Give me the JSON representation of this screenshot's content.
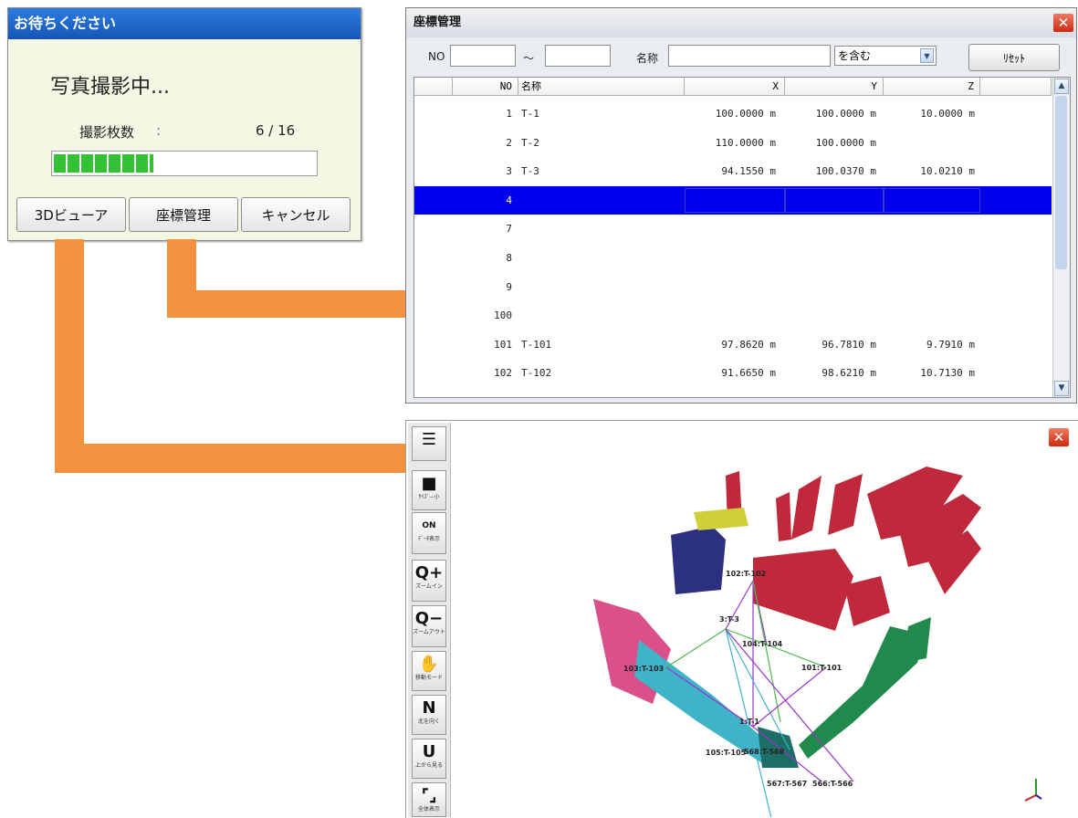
{
  "wait_dialog": {
    "title": "お待ちください",
    "message": "写真撮影中...",
    "count_label": "撮影枚数",
    "count_separator": ":",
    "count_value": "6 / 16",
    "progress_fraction": 0.375,
    "buttons": [
      "3Dビューア",
      "座標管理",
      "キャンセル"
    ]
  },
  "coord_dialog": {
    "title": "座標管理",
    "close_glyph": "✕",
    "filter": {
      "no_label": "NO",
      "no_from": "",
      "range_separator": "～",
      "no_to": "",
      "name_label": "名称",
      "name_value": "",
      "match_mode": "を含む",
      "reset_label": "ﾘｾｯﾄ"
    },
    "columns": [
      "NO",
      "名称",
      "X",
      "Y",
      "Z"
    ],
    "rows": [
      {
        "no": "1",
        "name": "T-1",
        "x": "100.0000 m",
        "y": "100.0000 m",
        "z": "10.0000 m"
      },
      {
        "no": "2",
        "name": "T-2",
        "x": "110.0000 m",
        "y": "100.0000 m",
        "z": ""
      },
      {
        "no": "3",
        "name": "T-3",
        "x": "94.1550 m",
        "y": "100.0370 m",
        "z": "10.0210 m"
      },
      {
        "no": "4",
        "name": "",
        "x": "",
        "y": "",
        "z": "",
        "selected": true
      },
      {
        "no": "7",
        "name": "",
        "x": "",
        "y": "",
        "z": ""
      },
      {
        "no": "8",
        "name": "",
        "x": "",
        "y": "",
        "z": ""
      },
      {
        "no": "9",
        "name": "",
        "x": "",
        "y": "",
        "z": ""
      },
      {
        "no": "100",
        "name": "",
        "x": "",
        "y": "",
        "z": ""
      },
      {
        "no": "101",
        "name": "T-101",
        "x": "97.8620 m",
        "y": "96.7810 m",
        "z": "9.7910 m"
      },
      {
        "no": "102",
        "name": "T-102",
        "x": "91.6650 m",
        "y": "98.6210 m",
        "z": "10.7130 m"
      }
    ]
  },
  "viewer": {
    "close_glyph": "✕",
    "tools": [
      {
        "icon": "list-icon",
        "glyph": "☰",
        "caption": ""
      },
      {
        "icon": "point-size-icon",
        "glyph": "■",
        "caption": "ｻｲｽﾞ−小"
      },
      {
        "icon": "data-display-icon",
        "glyph": "ON",
        "caption": "ﾃﾞｰﾀ表示"
      },
      {
        "icon": "zoom-in-icon",
        "glyph": "Q+",
        "caption": "ズームイン"
      },
      {
        "icon": "zoom-out-icon",
        "glyph": "Q−",
        "caption": "ズームアウト"
      },
      {
        "icon": "pan-hand-icon",
        "glyph": "✋",
        "caption": "移動モード"
      },
      {
        "icon": "north-view-icon",
        "glyph": "N",
        "caption": "北を向く"
      },
      {
        "icon": "top-view-icon",
        "glyph": "U",
        "caption": "上から見る"
      },
      {
        "icon": "fit-all-icon",
        "glyph": "⌜⌟",
        "caption": "全体表示"
      }
    ],
    "point_labels": [
      "102:T-102",
      "3:T-3",
      "104:T-104",
      "103:T-103",
      "101:T-101",
      "1:T-1",
      "105:T-105",
      "568:T-568",
      "567:T-567",
      "566:T-566"
    ],
    "colors": {
      "red": "#c0283c",
      "green": "#1f8a4c",
      "cyan": "#3fb3c8",
      "pink": "#d9508a",
      "navy": "#2b3180",
      "yellow": "#cfcf3a"
    }
  }
}
